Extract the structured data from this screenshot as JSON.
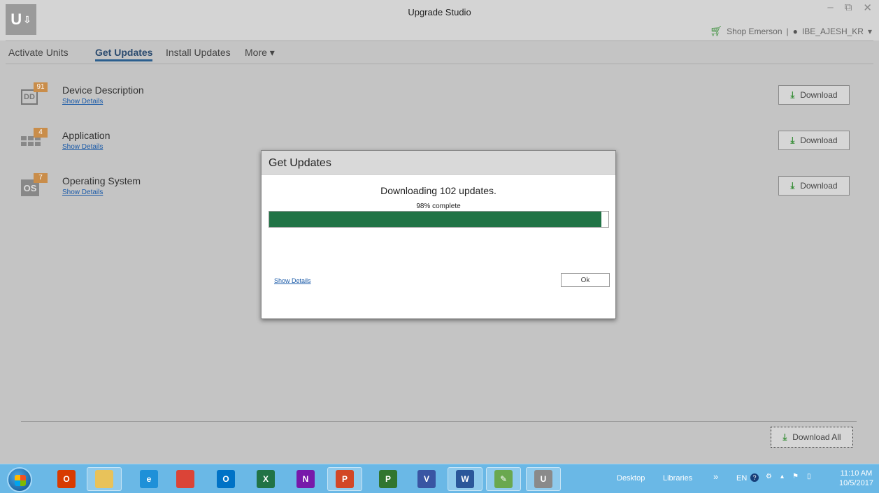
{
  "window": {
    "title": "Upgrade Studio",
    "logo_text": "U",
    "controls": [
      "–",
      "⧉",
      "✕"
    ]
  },
  "userbar": {
    "shop_label": "Shop Emerson",
    "separator": "|",
    "user_name": "IBE_AJESH_KR",
    "user_caret": "▾"
  },
  "nav": {
    "items": [
      {
        "label": "Activate Units"
      },
      {
        "label": "Get Updates",
        "active": true
      },
      {
        "label": "Install Updates"
      },
      {
        "label": "More ▾"
      }
    ]
  },
  "updates": [
    {
      "title": "Device Description",
      "badge": "91",
      "icon": "dd-icon",
      "icon_text": "DD",
      "link": "Show Details",
      "button": "Download"
    },
    {
      "title": "Application",
      "badge": "4",
      "icon": "application-grid-icon",
      "icon_text": "",
      "link": "Show Details",
      "button": "Download"
    },
    {
      "title": "Operating System",
      "badge": "7",
      "icon": "os-icon",
      "icon_text": "OS",
      "link": "Show Details",
      "button": "Download"
    }
  ],
  "download_all_label": "Download All",
  "dialog": {
    "title": "Get Updates",
    "message": "Downloading 102 updates.",
    "percent_text": "98% complete",
    "progress": 0.98,
    "show_details": "Show Details",
    "ok_label": "Ok"
  },
  "taskbar": {
    "apps": [
      {
        "name": "office-icon",
        "text": "O",
        "color": "#d83b01"
      },
      {
        "name": "file-explorer-icon",
        "text": "",
        "color": "#e8c25a",
        "pinned": true
      },
      {
        "name": "internet-explorer-icon",
        "text": "e",
        "color": "#1e90d8"
      },
      {
        "name": "chrome-icon",
        "text": "",
        "color": "#db4437"
      },
      {
        "name": "outlook-icon",
        "text": "O",
        "color": "#0072c6"
      },
      {
        "name": "excel-icon",
        "text": "X",
        "color": "#217346"
      },
      {
        "name": "onenote-icon",
        "text": "N",
        "color": "#7719aa"
      },
      {
        "name": "powerpoint-icon",
        "text": "P",
        "color": "#d24726",
        "pinned": true
      },
      {
        "name": "project-icon",
        "text": "P",
        "color": "#31752f"
      },
      {
        "name": "visio-icon",
        "text": "V",
        "color": "#3955a3"
      },
      {
        "name": "word-icon",
        "text": "W",
        "color": "#2b579a",
        "pinned": true
      },
      {
        "name": "paint-icon",
        "text": "✎",
        "color": "#6aa84f",
        "pinned": true
      },
      {
        "name": "upgrade-studio-icon",
        "text": "U",
        "color": "#8a8a8a",
        "pinned": true
      }
    ],
    "tray": {
      "desktop": "Desktop",
      "libraries": "Libraries",
      "chevron": "»",
      "lang": "EN",
      "help": "?",
      "misc": [
        "⚙",
        "▴",
        "⚑",
        "▯"
      ],
      "time": "11:10 AM",
      "date": "10/5/2017"
    }
  }
}
